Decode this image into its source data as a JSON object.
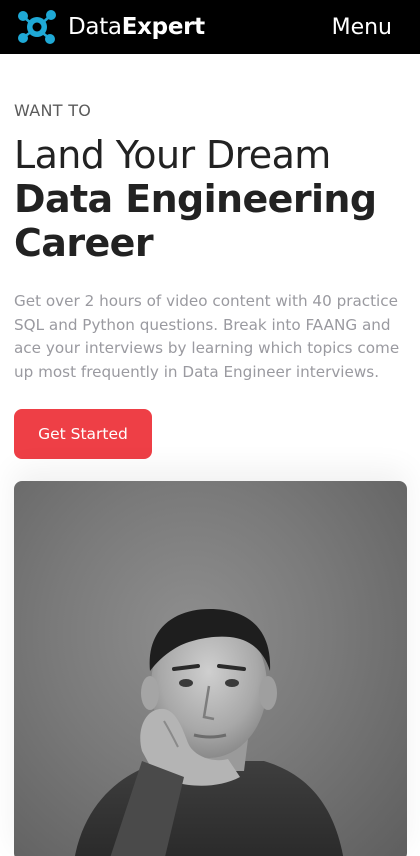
{
  "header": {
    "brand_light": "Data",
    "brand_bold": "Expert",
    "menu_label": "Menu",
    "logo_icon": "molecule-logo-icon",
    "background": "#000000",
    "logo_color": "#1fa9d6"
  },
  "hero": {
    "eyebrow": "WANT TO",
    "headline_line1": "Land Your Dream",
    "headline_line2": "Data Engineering Career",
    "description": "Get over 2 hours of video content with 40 practice SQL and Python questions. Break into FAANG and ace your interviews by learning which topics come up most frequently in Data Engineer interviews.",
    "cta_label": "Get Started",
    "cta_color": "#ee3f46"
  },
  "photo": {
    "alt_subject": "grayscale portrait of a man resting his chin on his hand"
  }
}
